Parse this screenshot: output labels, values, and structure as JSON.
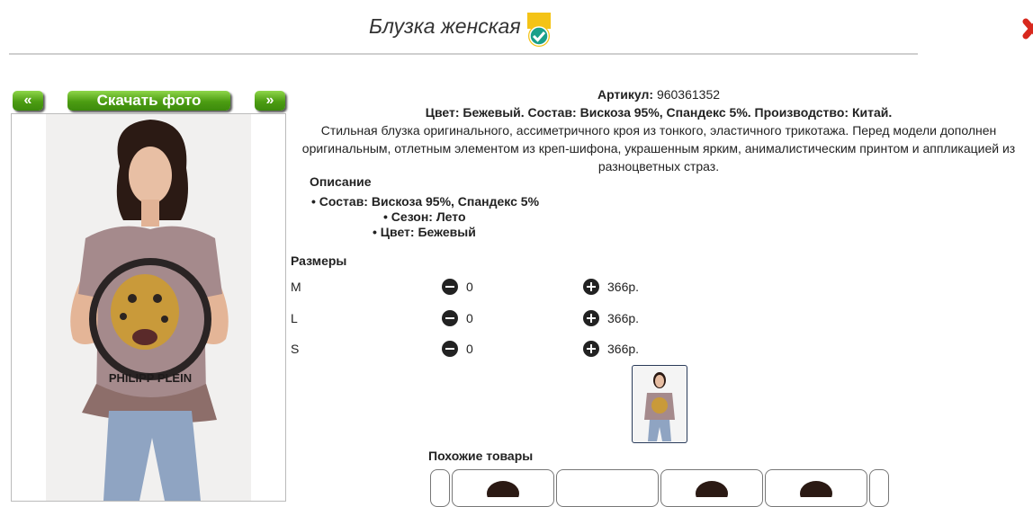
{
  "product": {
    "title": "Блузка женская",
    "article_label": "Артикул:",
    "article_value": "960361352",
    "summary": "Цвет: Бежевый. Состав: Вискоза 95%, Спандекс 5%. Производство: Китай.",
    "description_line1": "Стильная блузка оригинального, ассиметричного кроя из тонкого, эластичного трикотажа. Перед модели дополнен",
    "description_line2": "оригинальным, отлетным элементом из креп-шифона, украшенным ярким, анималистическим принтом и аппликацией из",
    "description_line3": "разноцветных страз."
  },
  "gallery": {
    "prev_label": "«",
    "download_label": "Скачать фото",
    "next_label": "»",
    "shirt_print_text": "PHILIPP PLEIN"
  },
  "details": {
    "heading": "Описание",
    "items": [
      "Состав: Вискоза 95%, Спандекс 5%",
      "Сезон: Лето",
      "Цвет: Бежевый"
    ]
  },
  "sizes": {
    "heading": "Размеры",
    "rows": [
      {
        "size": "M",
        "qty": "0",
        "price": "366р."
      },
      {
        "size": "L",
        "qty": "0",
        "price": "366р."
      },
      {
        "size": "S",
        "qty": "0",
        "price": "366р."
      }
    ]
  },
  "similar": {
    "heading": "Похожие товары"
  },
  "colors": {
    "accent_green": "#4c9d12",
    "badge_teal": "#1aa08a",
    "close_red": "#d8281d"
  }
}
